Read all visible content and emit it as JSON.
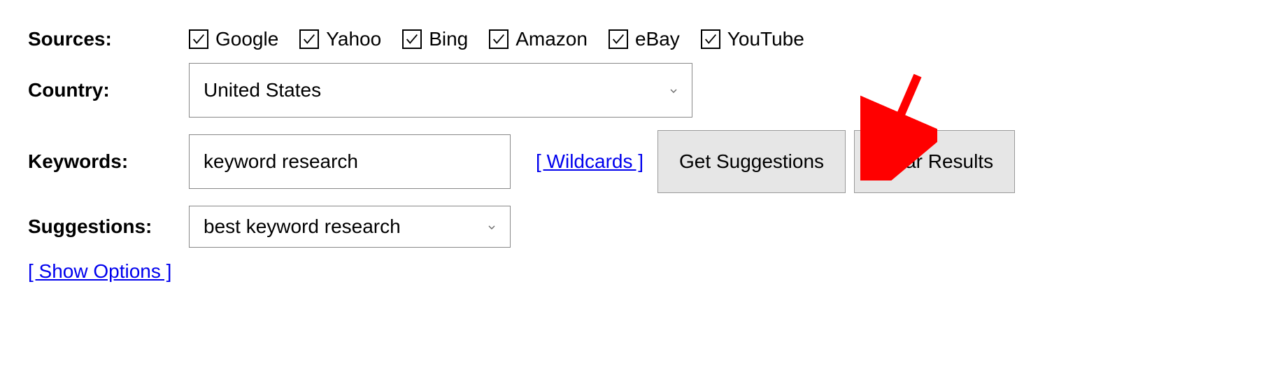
{
  "labels": {
    "sources": "Sources:",
    "country": "Country:",
    "keywords": "Keywords:",
    "suggestions": "Suggestions:"
  },
  "sources": [
    {
      "label": "Google",
      "checked": true
    },
    {
      "label": "Yahoo",
      "checked": true
    },
    {
      "label": "Bing",
      "checked": true
    },
    {
      "label": "Amazon",
      "checked": true
    },
    {
      "label": "eBay",
      "checked": true
    },
    {
      "label": "YouTube",
      "checked": true
    }
  ],
  "country": {
    "selected": "United States"
  },
  "keywords": {
    "value": "keyword research"
  },
  "links": {
    "wildcards": "[ Wildcards ]",
    "show_options": "[ Show Options ]"
  },
  "buttons": {
    "get_suggestions": "Get Suggestions",
    "clear_results": "Clear Results"
  },
  "suggestions": {
    "selected": "best keyword research"
  }
}
